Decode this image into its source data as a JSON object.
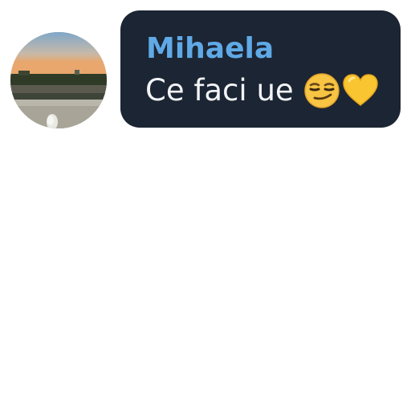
{
  "message": {
    "sender_name": "Mihaela",
    "text": "Ce faci ue",
    "emojis": [
      "smirking-face-emoji",
      "yellow-heart-emoji"
    ]
  },
  "colors": {
    "bubble_background": "#1c2533",
    "sender_name": "#5fa9e6",
    "message_text": "#f2f4f7",
    "page_background": "#ffffff"
  }
}
